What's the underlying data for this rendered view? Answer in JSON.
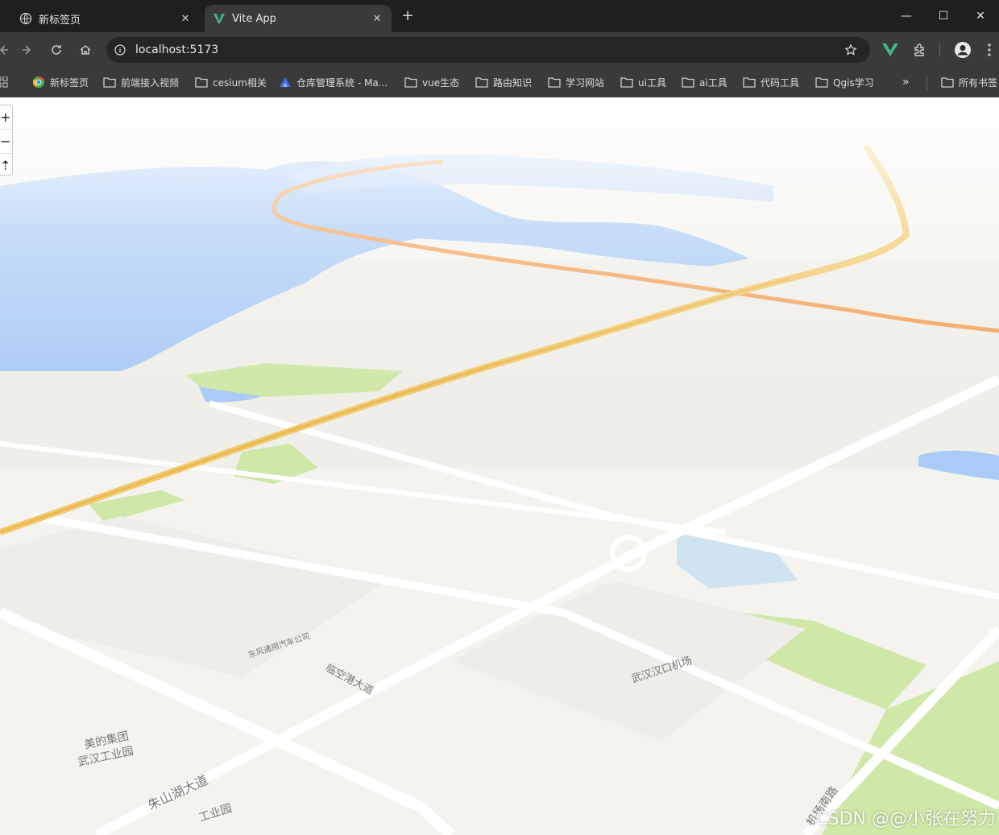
{
  "tabs": [
    {
      "title": "新标签页",
      "icon": "globe-icon",
      "active": false
    },
    {
      "title": "Vite App",
      "icon": "vite-logo-icon",
      "active": true
    }
  ],
  "address_bar": {
    "url": "localhost:5173"
  },
  "bookmarks": [
    {
      "label": "新标签页",
      "icon": "chrome-icon"
    },
    {
      "label": "前端接入视频",
      "icon": "folder-icon"
    },
    {
      "label": "cesium相关",
      "icon": "folder-icon"
    },
    {
      "label": "仓库管理系统 - Ma...",
      "icon": "app-logo-icon"
    },
    {
      "label": "vue生态",
      "icon": "folder-icon"
    },
    {
      "label": "路由知识",
      "icon": "folder-icon"
    },
    {
      "label": "学习网站",
      "icon": "folder-icon"
    },
    {
      "label": "ui工具",
      "icon": "folder-icon"
    },
    {
      "label": "ai工具",
      "icon": "folder-icon"
    },
    {
      "label": "代码工具",
      "icon": "folder-icon"
    },
    {
      "label": "Qgis学习",
      "icon": "folder-icon"
    }
  ],
  "bookmarks_more": "»",
  "all_bookmarks": "所有书签",
  "map_controls": {
    "zoom_in": "+",
    "zoom_out": "−",
    "reset_north": "⇡"
  },
  "map_labels": [
    "朱山湖大道",
    "工业园",
    "美的集团",
    "武汉工业园",
    "武汉汉口机场",
    "东风通用汽车公司",
    "临空港大道",
    "机场南路"
  ],
  "watermark": "CSDN @@小张在努力",
  "colors": {
    "water": "#aacbf5",
    "green": "#cfe8a8",
    "highway": "#f2c86a",
    "expressway": "#f2a35c",
    "land": "#f6f5f1"
  }
}
